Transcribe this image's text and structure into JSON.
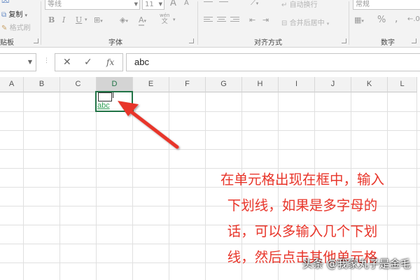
{
  "ribbon": {
    "clipboard": {
      "copy_label": "复制",
      "format_painter_label": "格式刷",
      "group_label": "贴板"
    },
    "font": {
      "font_name": "等线",
      "font_size": "11",
      "grow_font": "A",
      "shrink_font": "A",
      "bold": "B",
      "italic": "I",
      "underline": "U",
      "font_color_glyph": "A",
      "phonetic_glyph": "wén",
      "group_label": "字体"
    },
    "alignment": {
      "wrap_text_label": "自动换行",
      "merge_center_label": "合并后居中",
      "group_label": "对齐方式"
    },
    "number": {
      "format_value": "常规",
      "percent": "%",
      "comma": ",",
      "group_label": "数字"
    }
  },
  "formula_bar": {
    "cancel_glyph": "✕",
    "enter_glyph": "✓",
    "fx_glyph": "fx",
    "content": "abc"
  },
  "sheet": {
    "columns": [
      "A",
      "B",
      "C",
      "D",
      "E",
      "F",
      "G",
      "H",
      "I",
      "J",
      "K",
      "L"
    ],
    "active_column": "D",
    "cell_text": "abc"
  },
  "annotation": {
    "lines": [
      "在单元格出现在框中，输入",
      "下划线，如果是多字母的",
      "话，可以多输入几个下划",
      "线，然后点击其他单元格"
    ],
    "color": "#e8352a"
  },
  "watermark": "头条 @我家丸子是金毛",
  "colors": {
    "excel_green": "#217346",
    "cell_text_green": "#2f9e54"
  }
}
